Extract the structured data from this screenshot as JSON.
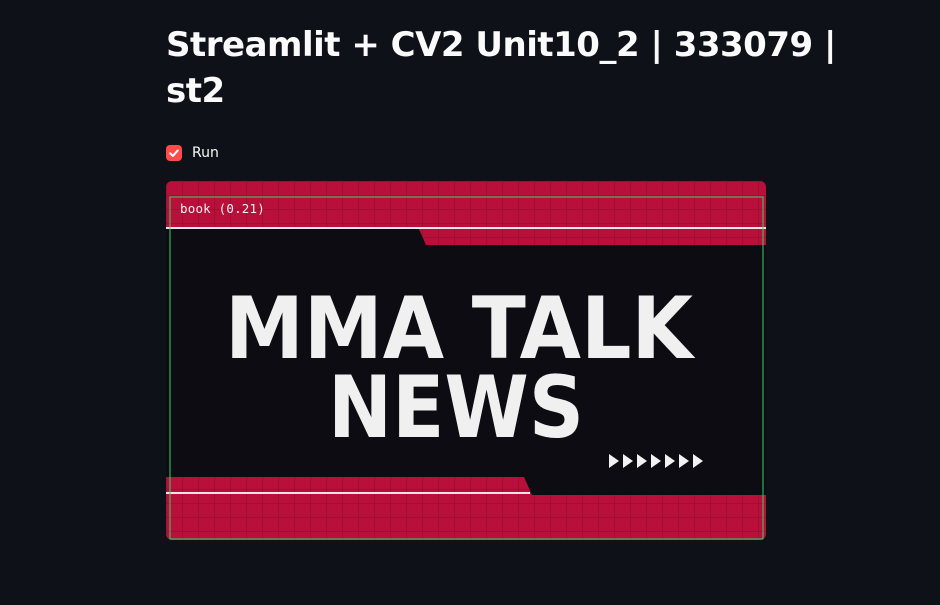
{
  "page": {
    "title": "Streamlit + CV2 Unit10_2 | 333079 | st2",
    "run_checkbox": {
      "label": "Run",
      "checked": true
    }
  },
  "video_frame": {
    "headline_line1": "MMA TALK",
    "headline_line2": "NEWS",
    "detection": {
      "label": "book (0.21)",
      "class": "book",
      "confidence": 0.21
    },
    "colors": {
      "banner_red": "#b8103a",
      "background": "#0d0c12",
      "box_green": "#2fd36b",
      "text": "#f0f0f0"
    }
  }
}
